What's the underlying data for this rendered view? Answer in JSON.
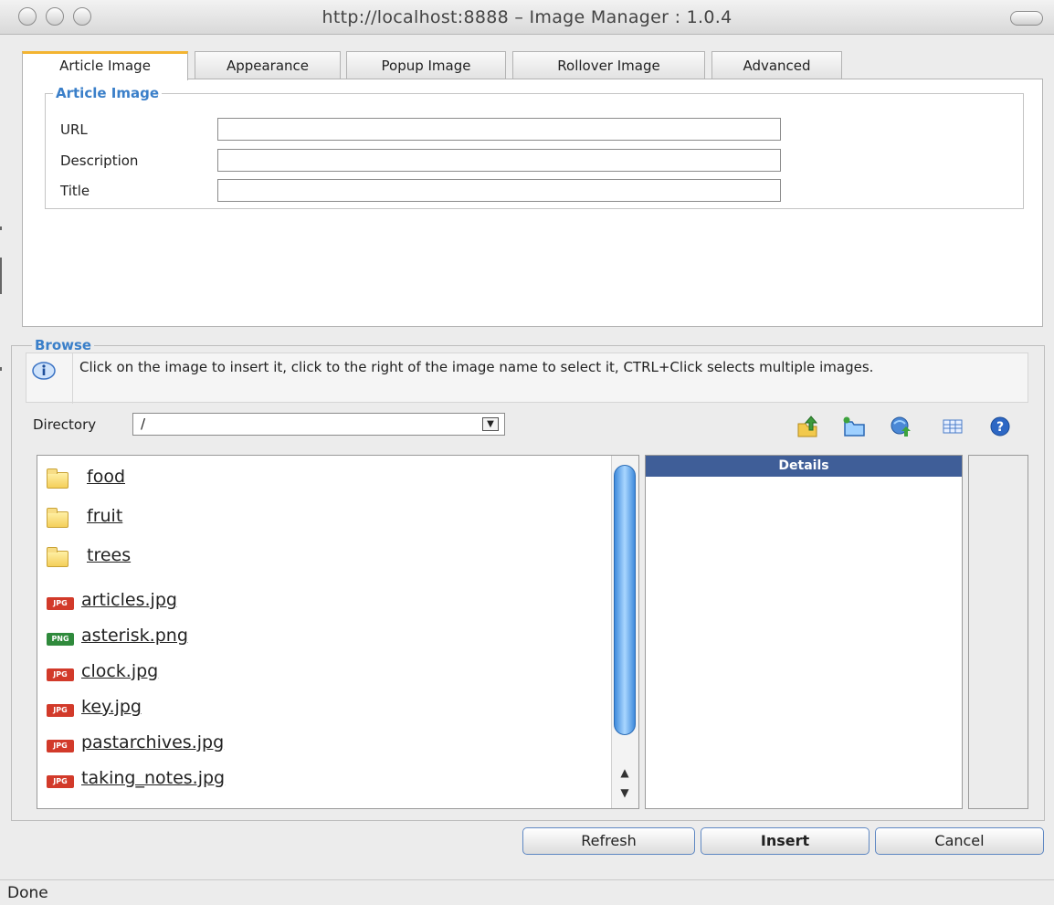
{
  "window": {
    "title": "http://localhost:8888 – Image Manager : 1.0.4"
  },
  "tabs": [
    {
      "label": "Article Image",
      "active": true
    },
    {
      "label": "Appearance",
      "active": false
    },
    {
      "label": "Popup Image",
      "active": false
    },
    {
      "label": "Rollover Image",
      "active": false
    },
    {
      "label": "Advanced",
      "active": false
    }
  ],
  "article_image": {
    "legend": "Article Image",
    "fields": [
      {
        "label": "URL",
        "value": ""
      },
      {
        "label": "Description",
        "value": ""
      },
      {
        "label": "Title",
        "value": ""
      }
    ]
  },
  "browse": {
    "legend": "Browse",
    "info_text": "Click on the image to insert it, click to the right of the image name to select it, CTRL+Click selects multiple images.",
    "directory_label": "Directory",
    "directory_value": "/",
    "toolbar_icons": [
      "up-folder-icon",
      "new-folder-icon",
      "upload-icon",
      "view-mode-icon",
      "help-icon"
    ],
    "folders": [
      "food",
      "fruit",
      "trees"
    ],
    "files": [
      {
        "name": "articles.jpg",
        "type": "JPG"
      },
      {
        "name": "asterisk.png",
        "type": "PNG"
      },
      {
        "name": "clock.jpg",
        "type": "JPG"
      },
      {
        "name": "key.jpg",
        "type": "JPG"
      },
      {
        "name": "pastarchives.jpg",
        "type": "JPG"
      },
      {
        "name": "taking_notes.jpg",
        "type": "JPG"
      }
    ],
    "details_header": "Details"
  },
  "buttons": {
    "refresh": "Refresh",
    "insert": "Insert",
    "cancel": "Cancel"
  },
  "status": "Done",
  "colors": {
    "accent_tab": "#f3b431",
    "legend_blue": "#3a7fc9",
    "details_header": "#3f5e98",
    "jpg_badge": "#d23a2a",
    "png_badge": "#2f8a3c"
  }
}
